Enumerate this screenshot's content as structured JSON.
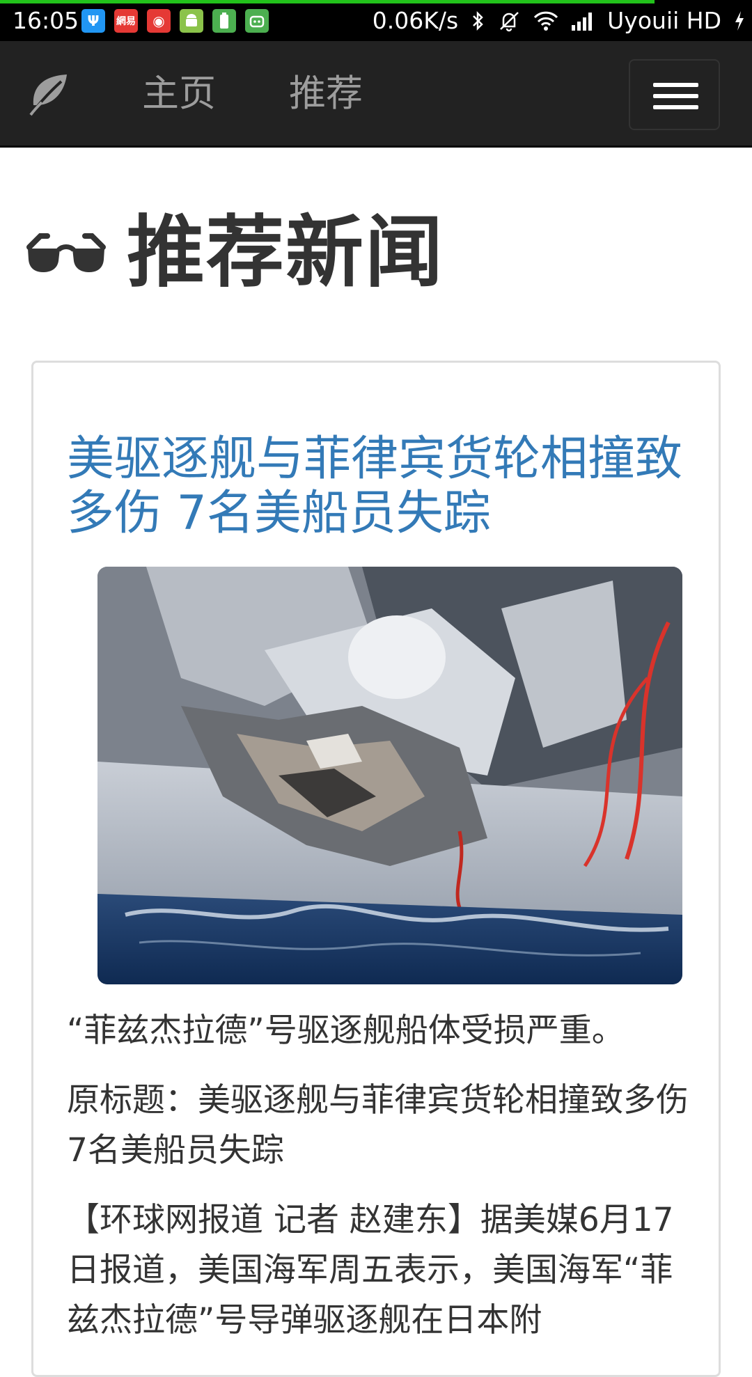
{
  "status_bar": {
    "time": "16:05",
    "network_speed": "0.06K/s",
    "carrier": "Uyouii HD",
    "notification_icons": [
      "usb-icon",
      "netease-icon",
      "weibo-icon",
      "android-icon",
      "battery-app-icon",
      "android-robot-icon"
    ],
    "system_icons": [
      "bluetooth-icon",
      "mute-vibrate-icon",
      "wifi-icon",
      "signal-icon",
      "charging-icon"
    ],
    "progress": 0.87
  },
  "navbar": {
    "home_label": "主页",
    "recommend_label": "推荐",
    "brand_icon": "leaf-icon",
    "toggle_icon": "hamburger-menu-icon"
  },
  "page": {
    "heading": "推荐新闻",
    "heading_icon": "sunglasses-icon"
  },
  "article": {
    "title": "美驱逐舰与菲律宾货轮相撞致多伤 7名美船员失踪",
    "image_alt": "damaged-destroyer-photo",
    "caption": "“菲兹杰拉德”号驱逐舰船体受损严重。",
    "paragraph_1": "原标题：美驱逐舰与菲律宾货轮相撞致多伤7名美船员失踪",
    "paragraph_2": "【环球网报道 记者 赵建东】据美媒6月17日报道，美国海军周五表示，美国海军“菲兹杰拉德”号导弹驱逐舰在日本附"
  },
  "colors": {
    "navbar_bg": "#222222",
    "nav_link": "#9d9d9d",
    "title_link": "#337ab7",
    "text": "#333333",
    "status_progress": "#22c21b"
  }
}
